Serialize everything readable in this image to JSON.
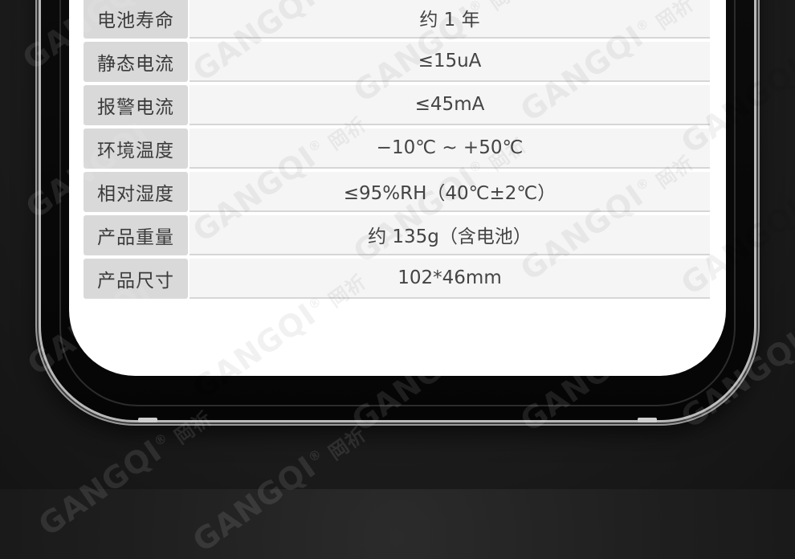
{
  "specs": [
    {
      "label": "电池寿命",
      "value": "约 1 年"
    },
    {
      "label": "静态电流",
      "value": "≤15uA"
    },
    {
      "label": "报警电流",
      "value": "≤45mA"
    },
    {
      "label": "环境温度",
      "value": "−10℃ ~ +50℃"
    },
    {
      "label": "相对湿度",
      "value": "≤95%RH（40℃±2℃）"
    },
    {
      "label": "产品重量",
      "value": "约 135g（含电池）"
    },
    {
      "label": "产品尺寸",
      "value": "102*46mm"
    }
  ],
  "watermark": {
    "brand": "GANGQI",
    "registered": "®",
    "cn": "岡祈"
  },
  "colors": {
    "label_bg": "#d9d9d9",
    "value_bg": "#f5f5f5",
    "text": "#444444",
    "background": "#1f1f1f"
  }
}
